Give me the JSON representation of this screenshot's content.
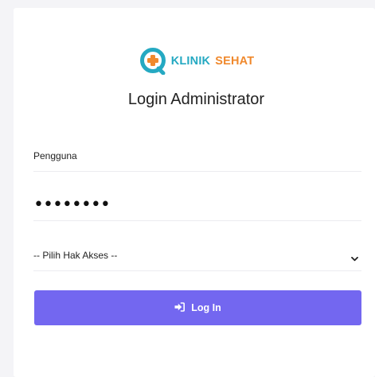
{
  "brand": {
    "word1": "KLINIK",
    "word2": "SEHAT",
    "color1": "#25a9c2",
    "color2": "#f0892d",
    "icon": "medical-cross-logo"
  },
  "title": "Login Administrator",
  "form": {
    "username_value": "Pengguna",
    "password_mask": "••••••••",
    "role_select_value": "-- Pilih Hak Akses --",
    "login_label": "Log In",
    "login_icon": "sign-in-icon",
    "button_color": "#7367f0"
  }
}
